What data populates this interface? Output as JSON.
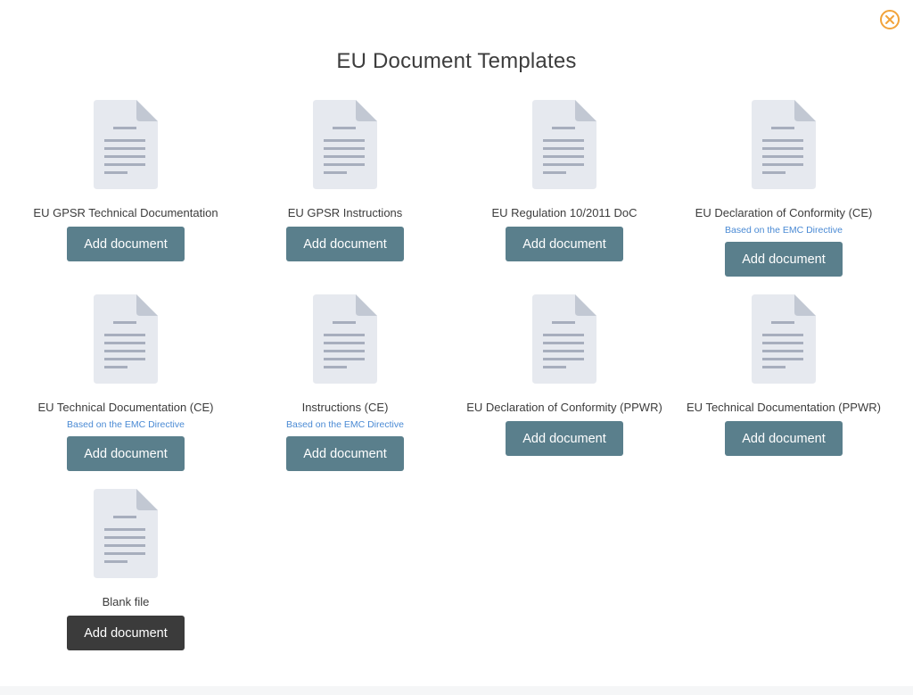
{
  "dialog": {
    "title": "EU Document Templates",
    "close_icon": "close-circle-icon",
    "accent_color": "#f2a33a"
  },
  "templates": [
    {
      "label": "EU GPSR Technical Documentation",
      "sub": "",
      "button": "Add document",
      "icon": "document-icon"
    },
    {
      "label": "EU GPSR Instructions",
      "sub": "",
      "button": "Add document",
      "icon": "document-icon"
    },
    {
      "label": "EU Regulation 10/2011 DoC",
      "sub": "",
      "button": "Add document",
      "icon": "document-icon"
    },
    {
      "label": "EU Declaration of Conformity (CE)",
      "sub": "Based on the EMC Directive",
      "button": "Add document",
      "icon": "document-icon"
    },
    {
      "label": "EU Technical Documentation (CE)",
      "sub": "Based on the EMC Directive",
      "button": "Add document",
      "icon": "document-icon"
    },
    {
      "label": "Instructions (CE)",
      "sub": "Based on the EMC Directive",
      "button": "Add document",
      "icon": "document-icon"
    },
    {
      "label": "EU Declaration of Conformity (PPWR)",
      "sub": "",
      "button": "Add document",
      "icon": "document-icon"
    },
    {
      "label": "EU Technical Documentation (PPWR)",
      "sub": "",
      "button": "Add document",
      "icon": "document-icon"
    },
    {
      "label": "Blank file",
      "sub": "",
      "button": "Add document",
      "icon": "document-icon"
    }
  ],
  "colors": {
    "button": "#5a7f8c",
    "button_blank": "#3b3b3b",
    "subtitle": "#4a8ad4"
  }
}
